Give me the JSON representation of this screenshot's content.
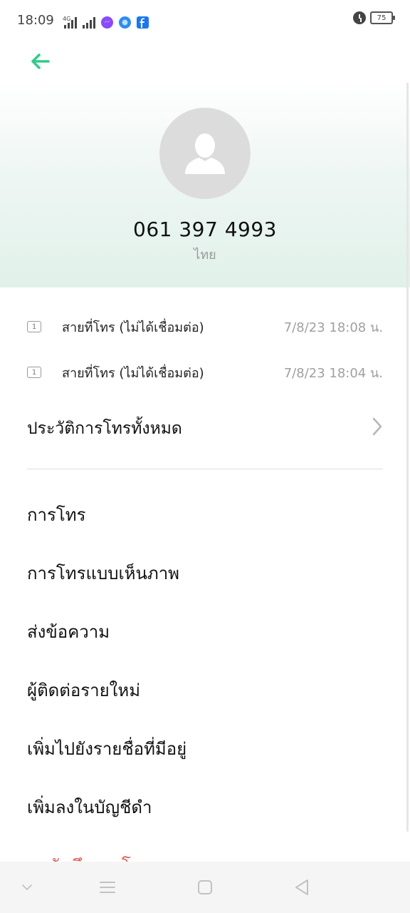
{
  "status_bar": {
    "time": "18:09",
    "network_type": "4G",
    "battery": "75",
    "apps": [
      "messenger-icon",
      "messenger-lite-icon",
      "facebook-icon"
    ]
  },
  "contact": {
    "number": "061 397 4993",
    "location": "ไทย"
  },
  "call_log": [
    {
      "sim": "1",
      "label": "สายที่โทร (ไม่ได้เชื่อมต่อ)",
      "time": "7/8/23 18:08 น."
    },
    {
      "sim": "1",
      "label": "สายที่โทร (ไม่ได้เชื่อมต่อ)",
      "time": "7/8/23 18:04 น."
    }
  ],
  "history_label": "ประวัติการโทรทั้งหมด",
  "actions": [
    "การโทร",
    "การโทรแบบเห็นภาพ",
    "ส่งข้อความ",
    "ผู้ติดต่อรายใหม่",
    "เพิ่มไปยังรายชื่อที่มีอยู่",
    "เพิ่มลงในบัญชีดำ",
    "ลบบันทึกการโทร"
  ],
  "colors": {
    "accent": "#2ecc8a",
    "danger": "#e15a5a",
    "header_tint": "#e1f1ea"
  }
}
